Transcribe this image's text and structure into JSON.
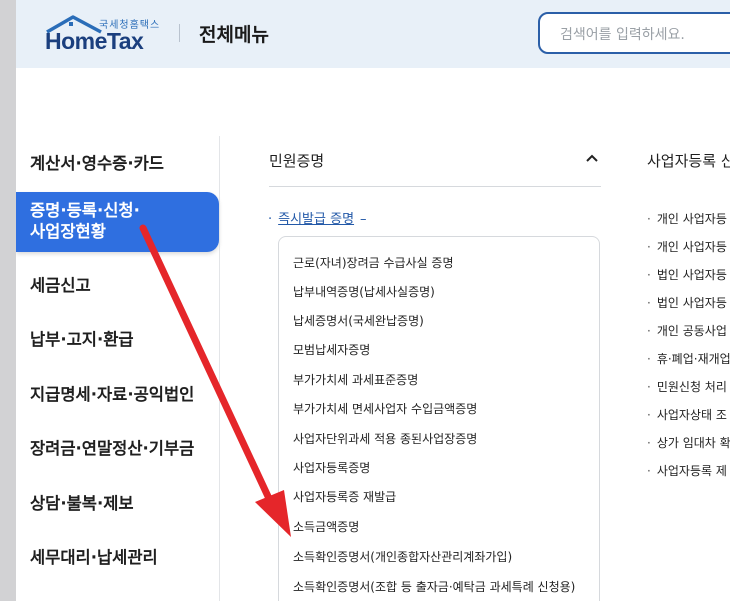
{
  "header": {
    "logo_sub": "국세청홈택스",
    "logo_main": "HomeTax",
    "title": "전체메뉴",
    "search_placeholder": "검색어를 입력하세요."
  },
  "sidebar": {
    "items": [
      {
        "label": "계산서·영수증·카드"
      },
      {
        "label_line1": "증명·등록·신청·",
        "label_line2": "사업장현황",
        "active": true
      },
      {
        "label": "세금신고"
      },
      {
        "label": "납부·고지·환급"
      },
      {
        "label": "지급명세·자료·공익법인"
      },
      {
        "label": "장려금·연말정산·기부금"
      },
      {
        "label": "상담·불복·제보"
      },
      {
        "label": "세무대리·납세관리"
      }
    ]
  },
  "main": {
    "section_title": "민원증명",
    "subsection": {
      "bullet": "·",
      "label": "즉시발급 증명",
      "dash": "–"
    },
    "list": [
      "근로(자녀)장려금 수급사실 증명",
      "납부내역증명(납세사실증명)",
      "납세증명서(국세완납증명)",
      "모범납세자증명",
      "부가가치세 과세표준증명",
      "부가가치세 면세사업자 수입금액증명",
      "사업자단위과세 적용 종된사업장증명",
      "사업자등록증명",
      "사업자등록증 재발급",
      "소득금액증명",
      "소득확인증명서(개인종합자산관리계좌가입)",
      "소득확인증명서(조합 등 출자금·예탁금 과세특례 신청용)"
    ]
  },
  "right": {
    "title": "사업자등록 신",
    "items": [
      "개인 사업자등",
      "개인 사업자등",
      "법인 사업자등",
      "법인 사업자등",
      "개인 공동사업",
      "휴·폐업·재개업",
      "민원신청 처리",
      "사업자상태 조",
      "상가 임대차 확",
      "사업자등록 제"
    ]
  },
  "colors": {
    "accent": "#2f6fe0",
    "arrow": "#e5262a",
    "link": "#2359a8",
    "header_bg": "#e8f0f8"
  }
}
